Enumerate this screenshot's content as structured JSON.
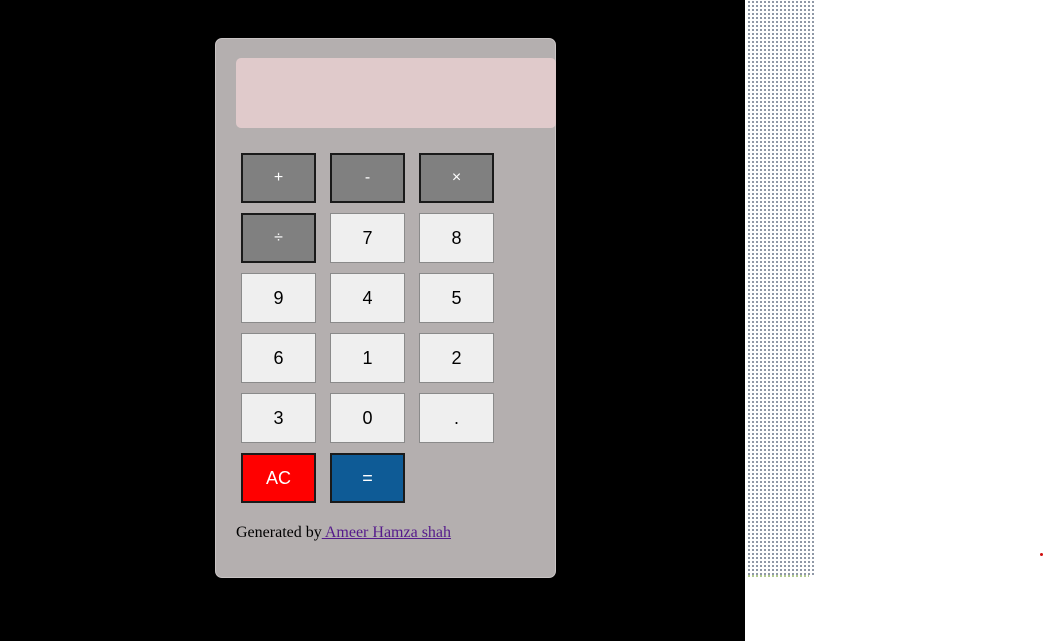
{
  "display": {
    "value": ""
  },
  "keys": [
    {
      "label": "+",
      "kind": "op",
      "name": "add-button"
    },
    {
      "label": "-",
      "kind": "op",
      "name": "subtract-button"
    },
    {
      "label": "×",
      "kind": "op",
      "name": "multiply-button"
    },
    {
      "label": "÷",
      "kind": "op",
      "name": "divide-button"
    },
    {
      "label": "7",
      "kind": "num",
      "name": "digit-7-button"
    },
    {
      "label": "8",
      "kind": "num",
      "name": "digit-8-button"
    },
    {
      "label": "9",
      "kind": "num",
      "name": "digit-9-button"
    },
    {
      "label": "4",
      "kind": "num",
      "name": "digit-4-button"
    },
    {
      "label": "5",
      "kind": "num",
      "name": "digit-5-button"
    },
    {
      "label": "6",
      "kind": "num",
      "name": "digit-6-button"
    },
    {
      "label": "1",
      "kind": "num",
      "name": "digit-1-button"
    },
    {
      "label": "2",
      "kind": "num",
      "name": "digit-2-button"
    },
    {
      "label": "3",
      "kind": "num",
      "name": "digit-3-button"
    },
    {
      "label": "0",
      "kind": "num",
      "name": "digit-0-button"
    },
    {
      "label": ".",
      "kind": "num",
      "name": "decimal-button"
    },
    {
      "label": "AC",
      "kind": "clear",
      "name": "all-clear-button"
    },
    {
      "label": "=",
      "kind": "equals",
      "name": "equals-button"
    }
  ],
  "footer": {
    "prefix": "Generated by",
    "author_link": " Ameer Hamza shah"
  },
  "colors": {
    "page_background": "#000000",
    "calculator_body": "#b4afaf",
    "display_background": "#e0cacb",
    "operator_key": "#808080",
    "number_key": "#efefef",
    "clear_key": "#ff0000",
    "equals_key": "#0e5b96",
    "link": "#551a8b"
  }
}
